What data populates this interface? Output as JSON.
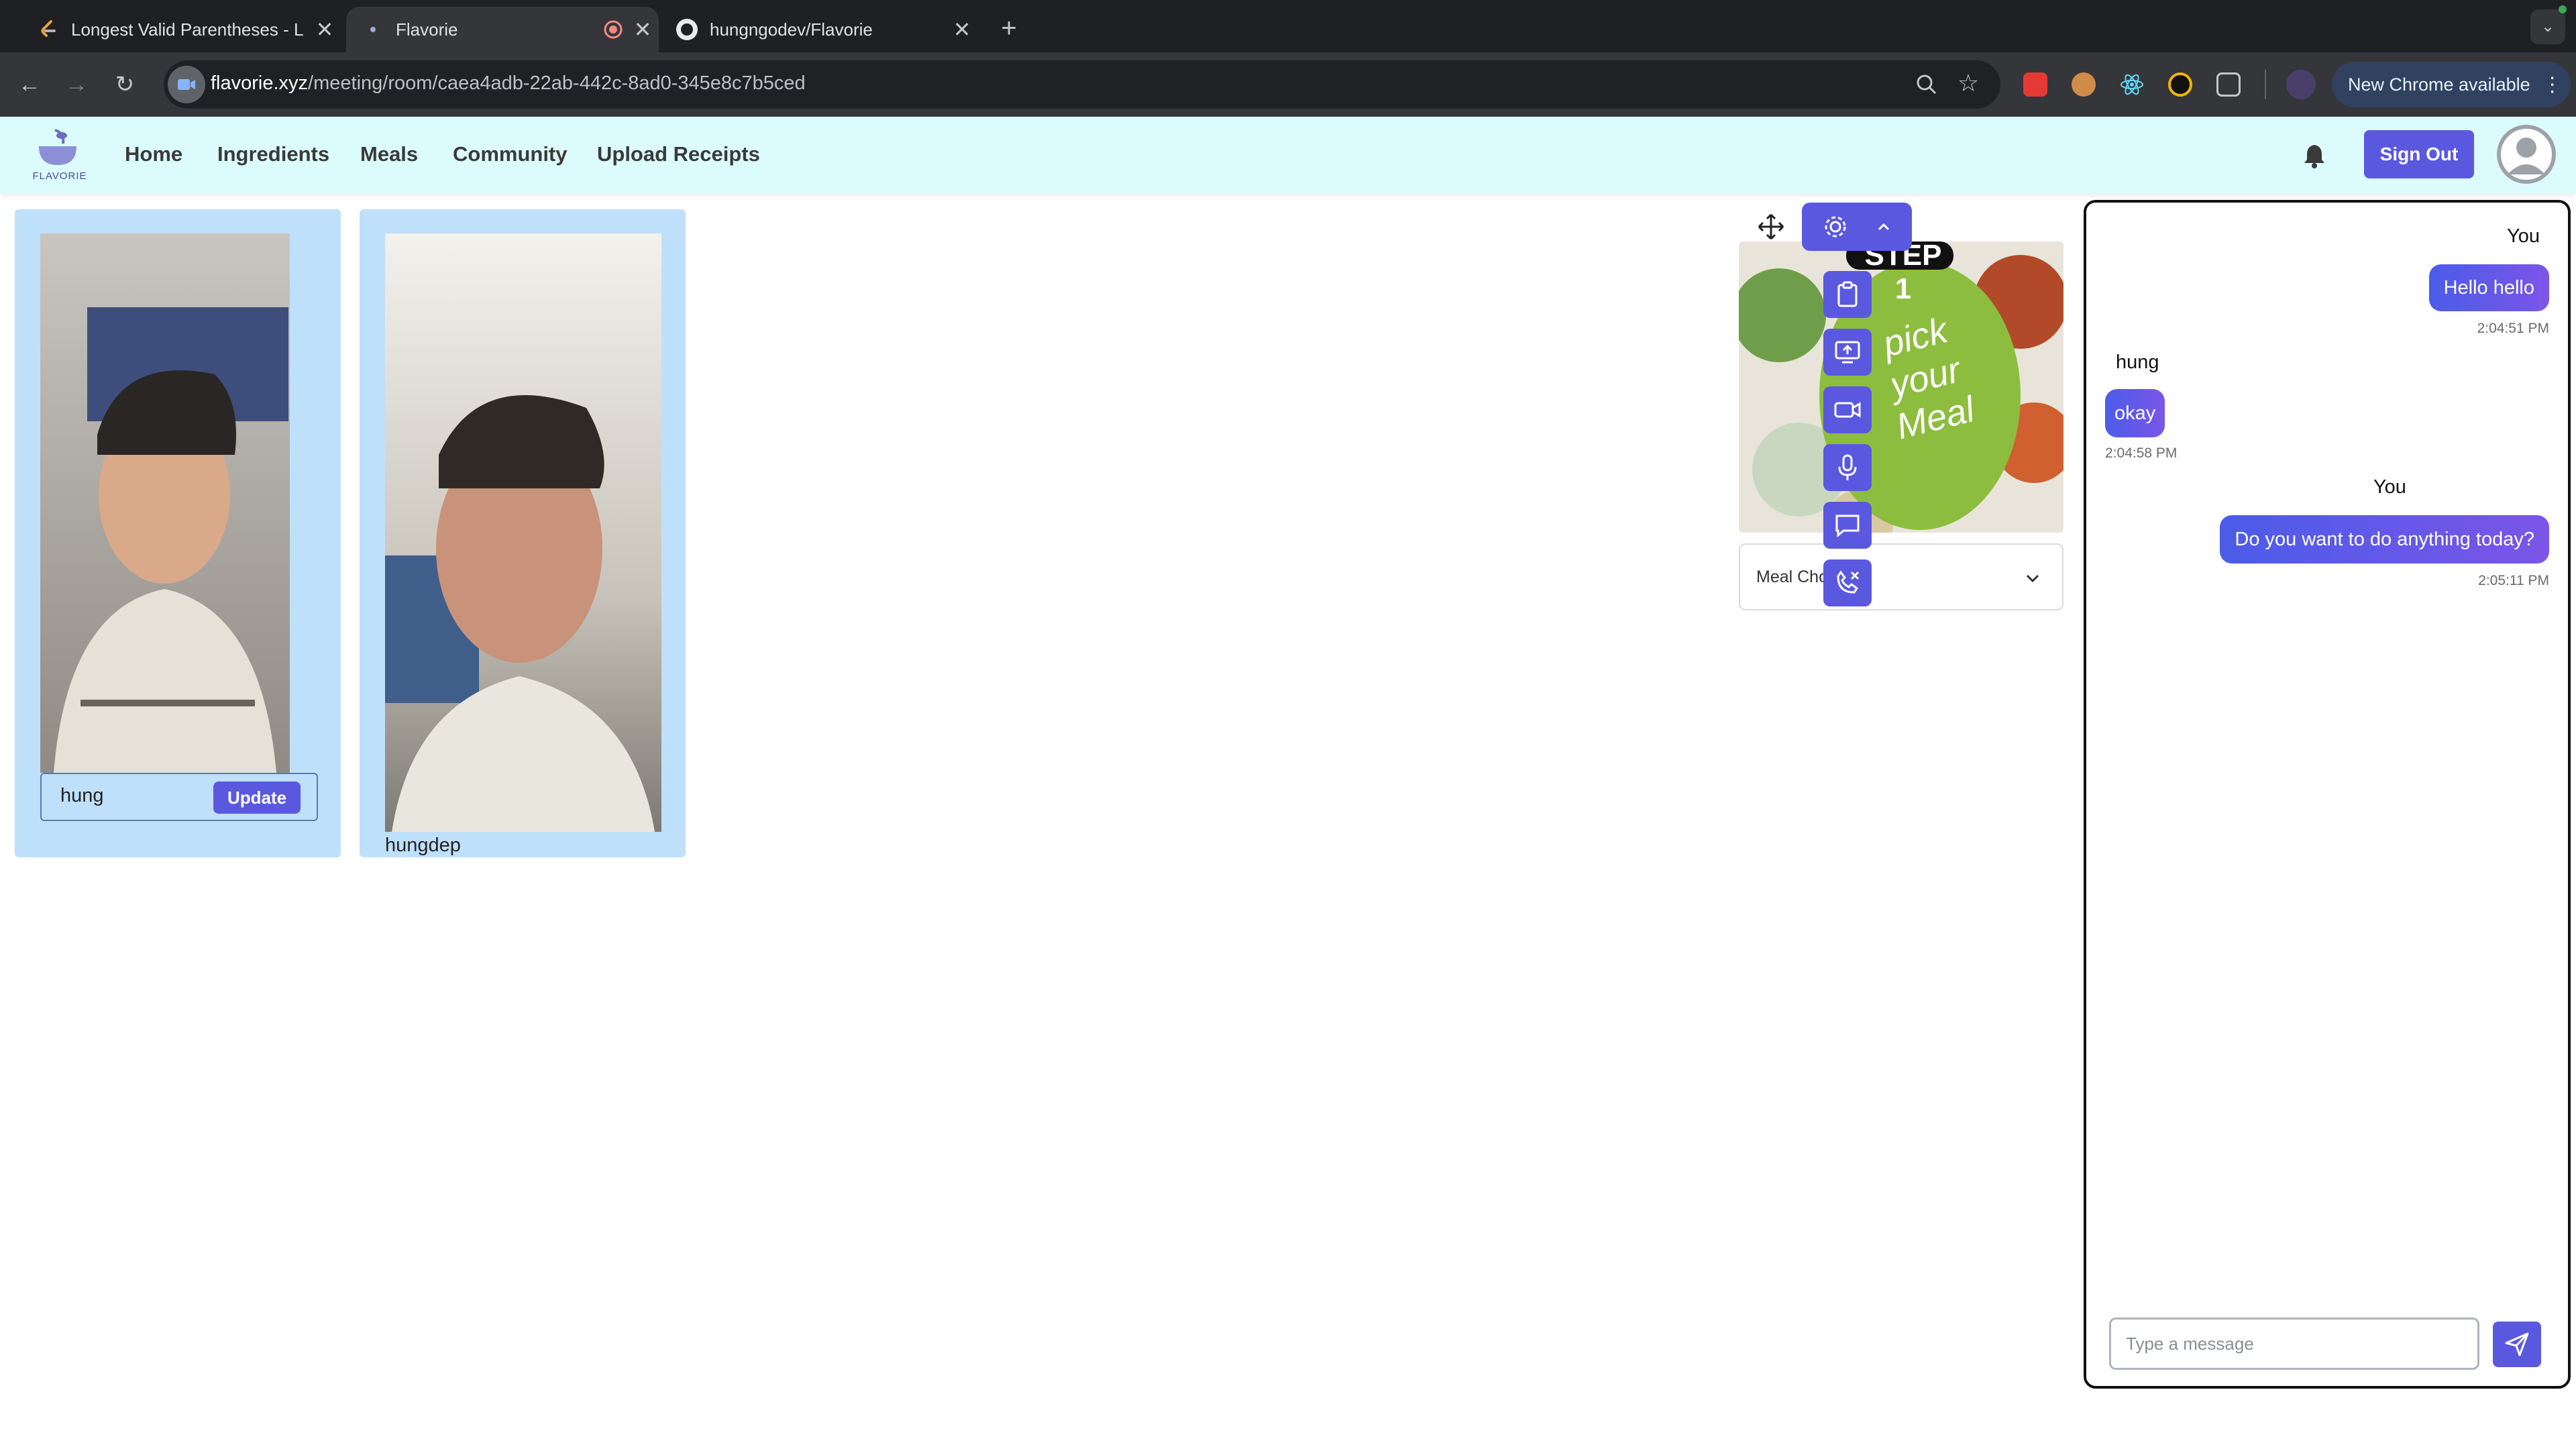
{
  "browser": {
    "tabs": [
      {
        "title": "Longest Valid Parentheses - L",
        "active": false
      },
      {
        "title": "Flavorie",
        "active": true
      },
      {
        "title": "hungngodev/Flavorie",
        "active": false
      }
    ],
    "url_host": "flavorie.xyz",
    "url_path": "/meeting/room/caea4adb-22ab-442c-8ad0-345e8c7b5ced",
    "new_chrome_label": "New Chrome available"
  },
  "app": {
    "brand": "FLAVORIE",
    "nav": [
      "Home",
      "Ingredients",
      "Meals",
      "Community",
      "Upload Receipts"
    ],
    "sign_out_label": "Sign Out"
  },
  "participants": [
    {
      "name": "hung",
      "button": "Update"
    },
    {
      "name": "hungdep"
    }
  ],
  "meal": {
    "image_text_top": "STEP 1",
    "image_text_main": "pick your Meal",
    "select_label": "Meal Cho"
  },
  "chat": {
    "messages": [
      {
        "sender": "You",
        "text": "Hello hello",
        "time": "2:04:51 PM",
        "mine": true
      },
      {
        "sender": "hung",
        "text": "okay",
        "time": "2:04:58 PM",
        "mine": false
      },
      {
        "sender": "You",
        "text": "Do you want to do anything today?",
        "time": "2:05:11 PM",
        "mine": true
      }
    ],
    "input_placeholder": "Type a message"
  },
  "colors": {
    "accent": "#5b58e0",
    "header_bg": "#dcfbfd",
    "card_bg": "#bfe0fb"
  }
}
